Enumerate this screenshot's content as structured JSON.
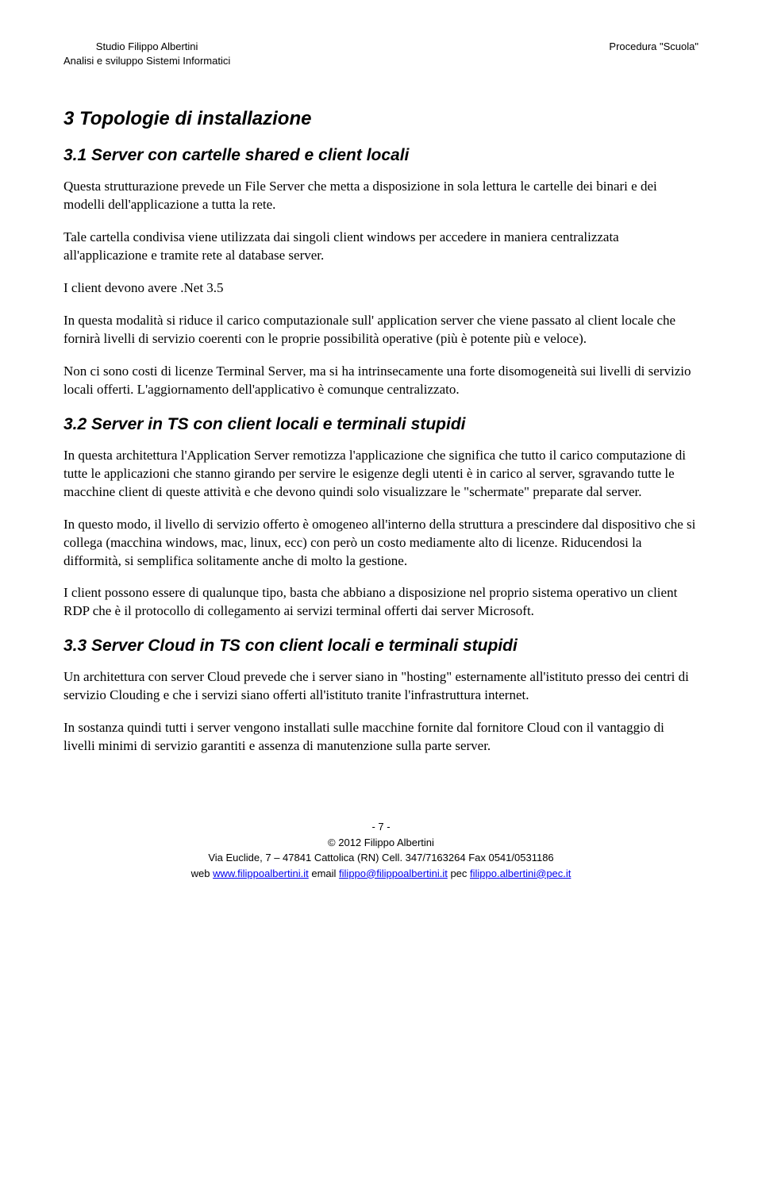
{
  "header": {
    "left_line1": "Studio Filippo Albertini",
    "left_line2": "Analisi e sviluppo Sistemi Informatici",
    "right_line1": "Procedura \"Scuola\""
  },
  "h1": "3  Topologie di installazione",
  "h2_1": "3.1  Server con cartelle shared e client locali",
  "p1": "Questa strutturazione prevede un File Server che metta a disposizione in sola lettura le cartelle dei binari e dei modelli dell'applicazione a tutta la rete.",
  "p2": "Tale cartella condivisa viene utilizzata dai singoli client windows per accedere in maniera centralizzata all'applicazione e tramite rete al database server.",
  "p3": "I client devono avere .Net 3.5",
  "p4": "In questa modalità si riduce il carico computazionale sull' application server che viene passato al client locale che fornirà livelli di servizio coerenti con le proprie possibilità operative (più è potente più e veloce).",
  "p5": "Non ci sono costi di licenze Terminal Server, ma si ha intrinsecamente una forte disomogeneità sui livelli di servizio locali offerti. L'aggiornamento dell'applicativo è comunque centralizzato.",
  "h2_2": "3.2  Server in TS con client locali e terminali stupidi",
  "p6": "In questa architettura l'Application Server remotizza l'applicazione che significa che tutto il carico computazione di tutte le applicazioni che stanno girando per servire le esigenze degli utenti è in carico al server, sgravando tutte le macchine client di queste attività e che devono quindi solo visualizzare le \"schermate\" preparate dal server.",
  "p7": "In questo modo, il livello di servizio offerto è omogeneo all'interno della struttura a prescindere dal dispositivo che si collega (macchina windows, mac, linux, ecc) con però un costo mediamente alto di licenze. Riducendosi la difformità, si semplifica solitamente anche di molto la gestione.",
  "p8": "I client possono essere di qualunque tipo, basta che abbiano a disposizione nel proprio sistema operativo un client RDP che è il protocollo di collegamento ai servizi terminal offerti dai server Microsoft.",
  "h2_3": "3.3  Server Cloud in TS con client locali e terminali stupidi",
  "p9": "Un architettura con server Cloud prevede che i server siano in \"hosting\" esternamente all'istituto presso dei centri di servizio Clouding e che i servizi siano offerti all'istituto tranite l'infrastruttura internet.",
  "p10": "In sostanza quindi tutti i server vengono installati sulle macchine fornite dal fornitore Cloud con il vantaggio di livelli minimi di servizio garantiti e assenza di manutenzione sulla parte server.",
  "footer": {
    "page": "- 7 -",
    "copyright": "© 2012 Filippo Albertini",
    "address": "Via Euclide, 7 – 47841 Cattolica (RN) Cell. 347/7163264 Fax 0541/0531186",
    "web_prefix": "web ",
    "web_link": "www.filippoalbertini.it",
    "email_prefix": " email ",
    "email_link": "filippo@filippoalbertini.it",
    "pec_prefix": " pec ",
    "pec_link": "filippo.albertini@pec.it"
  }
}
